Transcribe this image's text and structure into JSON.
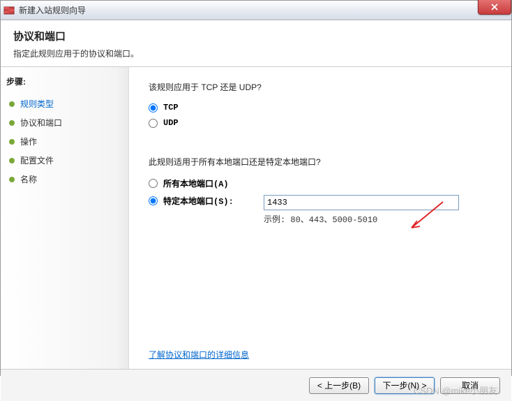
{
  "titlebar": {
    "title": "新建入站规则向导"
  },
  "header": {
    "title": "协议和端口",
    "desc": "指定此规则应用于的协议和端口。"
  },
  "sidebar": {
    "steps_label": "步骤:",
    "items": [
      {
        "label": "规则类型",
        "active": true
      },
      {
        "label": "协议和端口",
        "active": false
      },
      {
        "label": "操作",
        "active": false
      },
      {
        "label": "配置文件",
        "active": false
      },
      {
        "label": "名称",
        "active": false
      }
    ]
  },
  "main": {
    "q1": "该规则应用于 TCP 还是 UDP?",
    "tcp_label": "TCP",
    "udp_label": "UDP",
    "q2": "此规则适用于所有本地端口还是特定本地端口?",
    "all_ports_label": "所有本地端口(A)",
    "specific_ports_label": "特定本地端口(S):",
    "port_value": "1433",
    "example": "示例: 80、443、5000-5010",
    "link": "了解协议和端口的详细信息"
  },
  "footer": {
    "back": "< 上一步(B)",
    "next": "下一步(N) >",
    "cancel": "取消"
  },
  "watermark": "CSDN @mike小朋友"
}
